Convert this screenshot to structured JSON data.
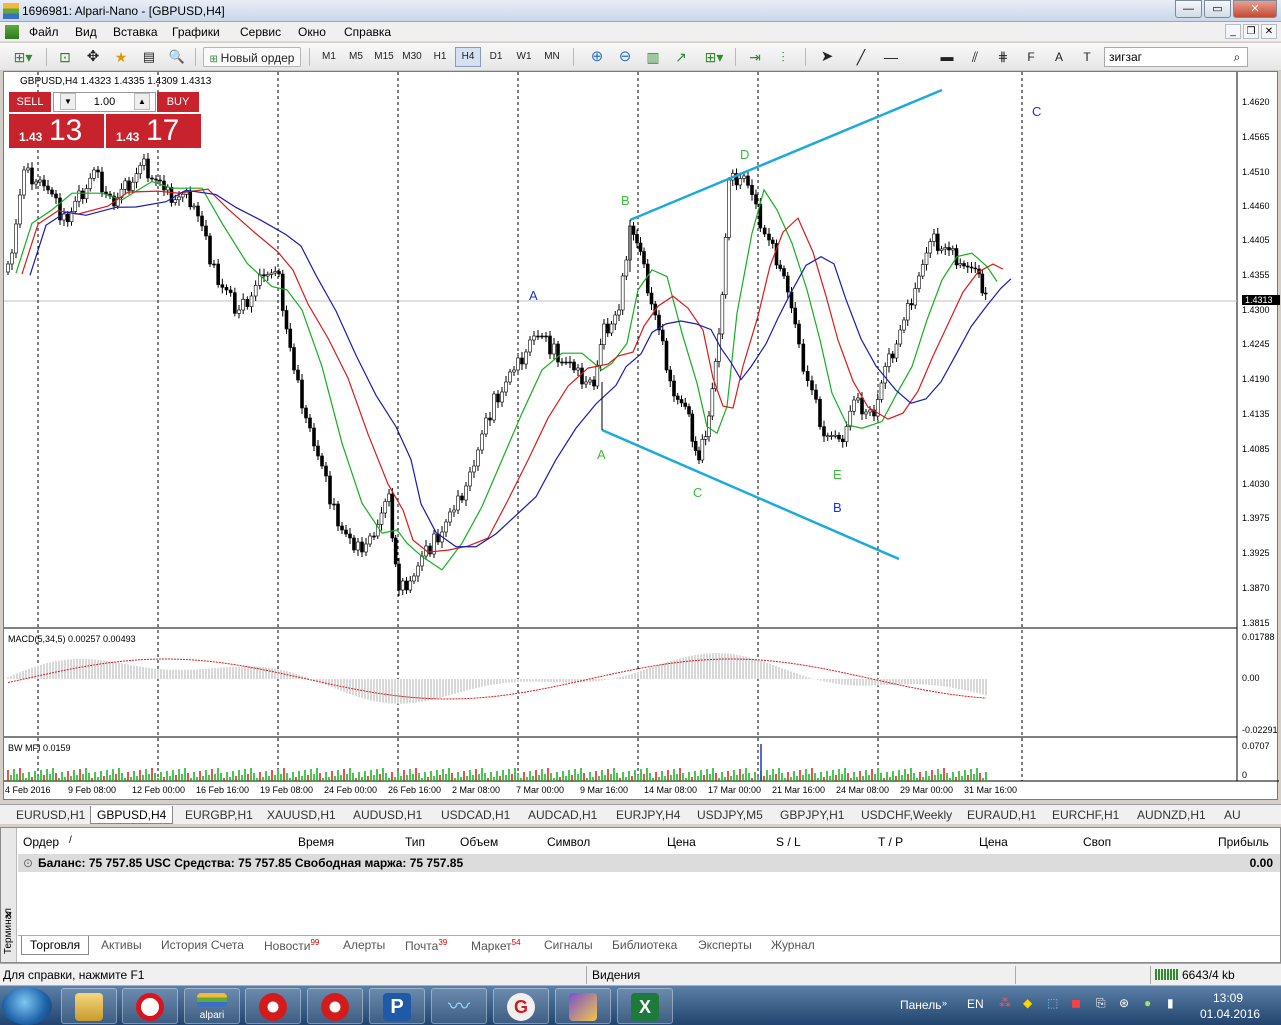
{
  "window": {
    "title": "1696981: Alpari-Nano - [GBPUSD,H4]",
    "buttons": {
      "min": "—",
      "max": "▭",
      "close": "✕"
    }
  },
  "menu": [
    "Файл",
    "Вид",
    "Вставка",
    "Графики",
    "Сервис",
    "Окно",
    "Справка"
  ],
  "toolbar": {
    "new_order": "Новый ордер",
    "timeframes": [
      "M1",
      "M5",
      "M15",
      "M30",
      "H1",
      "H4",
      "D1",
      "W1",
      "MN"
    ],
    "selected_timeframe": "H4",
    "search_value": "зигзаг"
  },
  "chart": {
    "title": "GBPUSD,H4  1.4323 1.4335 1.4309 1.4313",
    "trade": {
      "sell": "SELL",
      "buy": "BUY",
      "lot": "1.00",
      "sell_small": "1.43",
      "sell_big": "13",
      "buy_small": "1.43",
      "buy_big": "17"
    },
    "price_axis": [
      "1.4620",
      "1.4565",
      "1.4510",
      "1.4460",
      "1.4405",
      "1.4355",
      "1.4300",
      "1.4245",
      "1.4190",
      "1.4135",
      "1.4085",
      "1.4030",
      "1.3975",
      "1.3925",
      "1.3870",
      "1.3815"
    ],
    "current_price": "1.4313",
    "macd_title": "MACD(5,34,5) 0.00257 0.00493",
    "macd_axis": [
      "0.01788",
      "0.00",
      "-0.02291"
    ],
    "mfi_title": "BW MFI 0.0159",
    "mfi_axis": [
      "0.0707",
      "0"
    ],
    "time_axis": [
      "4 Feb 2016",
      "9 Feb 08:00",
      "12 Feb 00:00",
      "16 Feb 16:00",
      "19 Feb 08:00",
      "24 Feb 00:00",
      "26 Feb 16:00",
      "2 Mar 08:00",
      "7 Mar 00:00",
      "9 Mar 16:00",
      "14 Mar 08:00",
      "17 Mar 00:00",
      "21 Mar 16:00",
      "24 Mar 08:00",
      "29 Mar 00:00",
      "31 Mar 16:00"
    ],
    "wave_labels": {
      "blue": [
        "A",
        "B",
        "C"
      ],
      "green": [
        "A",
        "B",
        "C",
        "D",
        "E"
      ]
    },
    "colors": {
      "up_line": "#1ba9e0",
      "ma_fast": "#11b11b",
      "ma_mid": "#d81b1b",
      "ma_slow": "#1a1ab4",
      "wave_blue": "#1a35c8",
      "wave_green": "#3cba3c",
      "trade": "#c8232c"
    }
  },
  "symbol_tabs": [
    "EURUSD,H1",
    "GBPUSD,H4",
    "EURGBP,H1",
    "XAUUSD,H1",
    "AUDUSD,H1",
    "USDCAD,H1",
    "AUDCAD,H1",
    "EURJPY,H4",
    "USDJPY,M5",
    "GBPJPY,H1",
    "USDCHF,Weekly",
    "EURAUD,H1",
    "EURCHF,H1",
    "AUDNZD,H1",
    "AU"
  ],
  "terminal": {
    "side_label": "Терминал",
    "headers": [
      "Ордер",
      "Время",
      "Тип",
      "Объем",
      "Символ",
      "Цена",
      "S / L",
      "T / P",
      "Цена",
      "Своп",
      "Прибыль"
    ],
    "balance_text": "Баланс: 75 757.85 USC  Средства: 75 757.85  Свободная маржа: 75 757.85",
    "profit": "0.00",
    "tabs": [
      {
        "label": "Торговля",
        "badge": ""
      },
      {
        "label": "Активы",
        "badge": ""
      },
      {
        "label": "История Счета",
        "badge": ""
      },
      {
        "label": "Новости",
        "badge": "99"
      },
      {
        "label": "Алерты",
        "badge": ""
      },
      {
        "label": "Почта",
        "badge": "39"
      },
      {
        "label": "Маркет",
        "badge": "54"
      },
      {
        "label": "Сигналы",
        "badge": ""
      },
      {
        "label": "Библиотека",
        "badge": ""
      },
      {
        "label": "Эксперты",
        "badge": ""
      },
      {
        "label": "Журнал",
        "badge": ""
      }
    ]
  },
  "status": {
    "help": "Для справки, нажмите F1",
    "profile": "Видения",
    "traffic": "6643/4 kb"
  },
  "taskbar": {
    "apps": [
      "file-manager",
      "opera",
      "alpari",
      "app-gear",
      "app-gear",
      "p-app",
      "chart-app",
      "g-app",
      "pen-app",
      "excel"
    ],
    "alpari_label": "alpari",
    "panel": "Панель",
    "lang": "EN",
    "time": "13:09",
    "date": "01.04.2016"
  }
}
